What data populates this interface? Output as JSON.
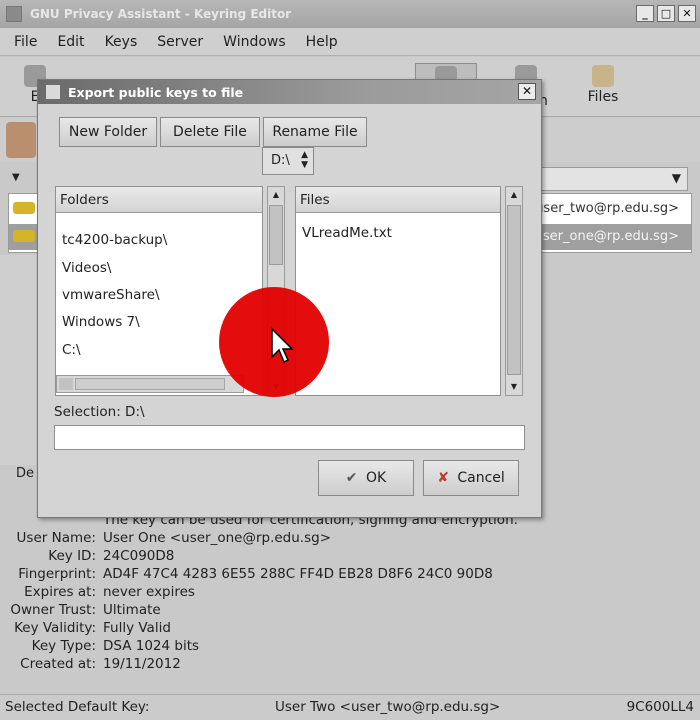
{
  "window": {
    "title": "GNU Privacy Assistant - Keyring Editor",
    "controls": [
      "_",
      "□",
      "✕"
    ]
  },
  "menu": [
    "File",
    "Edit",
    "Keys",
    "Server",
    "Windows",
    "Help"
  ],
  "toolbar": {
    "partial_left_label": "E",
    "partial_right_label": "n",
    "files_label": "Files"
  },
  "keys": [
    {
      "email": "<user_two@rp.edu.sg>",
      "selected": false
    },
    {
      "email": "<user_one@rp.edu.sg>",
      "selected": true
    }
  ],
  "details_label": "De",
  "details": {
    "partial_top": "The key can be used for certification, signing and encryption.",
    "rows": [
      {
        "label": "User Name:",
        "value": "User One <user_one@rp.edu.sg>"
      },
      {
        "label": "Key ID:",
        "value": "24C090D8"
      },
      {
        "label": "Fingerprint:",
        "value": "AD4F 47C4 4283 6E55 288C  FF4D EB28 D8F6 24C0 90D8"
      },
      {
        "label": "Expires at:",
        "value": "never expires"
      },
      {
        "label": "Owner Trust:",
        "value": "Ultimate"
      },
      {
        "label": "Key Validity:",
        "value": "Fully Valid"
      },
      {
        "label": "Key Type:",
        "value": "DSA 1024 bits"
      },
      {
        "label": "Created at:",
        "value": "19/11/2012"
      }
    ]
  },
  "status": {
    "label": "Selected Default Key:",
    "value": "User Two <user_two@rp.edu.sg>",
    "key_id": "9C600LL4"
  },
  "dialog": {
    "title": "Export public keys to file",
    "buttons": {
      "new_folder": "New Folder",
      "delete_file": "Delete File",
      "rename_file": "Rename File",
      "ok": "OK",
      "cancel": "Cancel"
    },
    "current_dir": "D:\\",
    "folders_header": "Folders",
    "files_header": "Files",
    "folders": [
      "tc4200-backup\\",
      "Videos\\",
      "vmwareShare\\",
      "Windows 7\\",
      "C:\\"
    ],
    "files": [
      "VLreadMe.txt"
    ],
    "selection_label": "Selection: D:\\",
    "selection_value": ""
  },
  "colors": {
    "highlight": "#e30000",
    "selected_row": "#9f9f9f",
    "window_bg": "#d4d4d4"
  }
}
